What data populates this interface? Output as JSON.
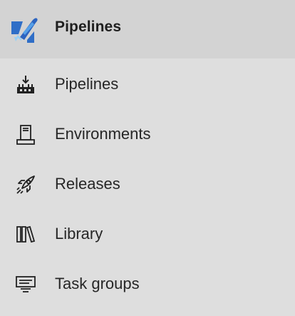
{
  "header": {
    "title": "Pipelines",
    "logo_icon": "azure-pipelines-logo",
    "colors": {
      "accent": "#2f6ec7",
      "accent_light": "#56a0e8",
      "highlight": "#9ad0f5"
    }
  },
  "items": [
    {
      "label": "Pipelines",
      "icon": "pipelines-icon"
    },
    {
      "label": "Environments",
      "icon": "environments-icon"
    },
    {
      "label": "Releases",
      "icon": "rocket-icon"
    },
    {
      "label": "Library",
      "icon": "library-icon"
    },
    {
      "label": "Task groups",
      "icon": "task-groups-icon"
    }
  ]
}
